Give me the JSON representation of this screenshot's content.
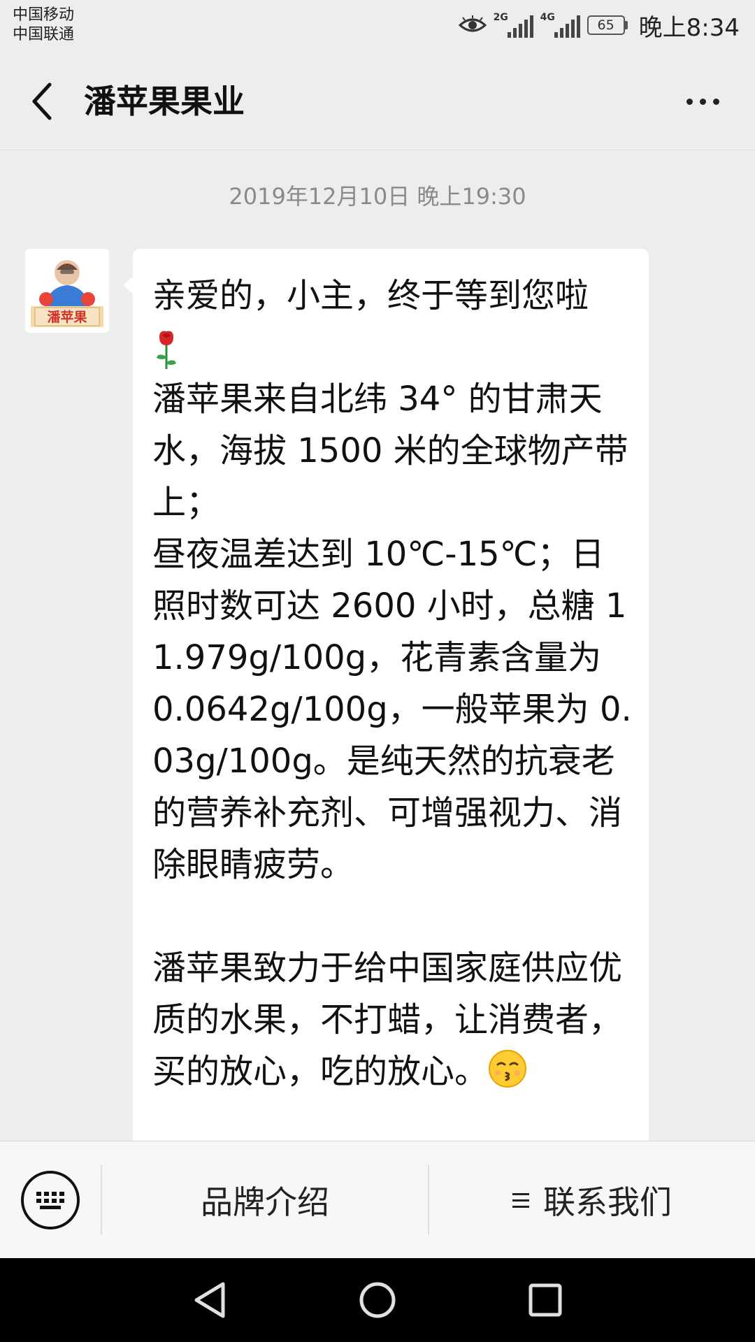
{
  "status_bar": {
    "carrier_1": "中国移动",
    "carrier_2": "中国联通",
    "signal_1_label": "2G",
    "signal_2_label": "4G",
    "battery": "65",
    "time": "晚上8:34"
  },
  "header": {
    "title": "潘苹果果业",
    "back_icon": "chevron-left-icon",
    "more_icon": "more-icon"
  },
  "chat": {
    "timestamp": "2019年12月10日 晚上19:30",
    "avatar_text": "潘苹果",
    "message": {
      "line1": "亲爱的，小主，终于等到您啦",
      "para1": "潘苹果来自北纬 34° 的甘肃天水，海拔 1500 米的全球物产带上；",
      "para2": "昼夜温差达到 10℃-15℃；日照时数可达 2600 小时，总糖 11.979g/100g，花青素含量为 0.0642g/100g，一般苹果为 0.03g/100g。是纯天然的抗衰老的营养补充剂、可增强视力、消除眼睛疲劳。",
      "para3": "潘苹果致力于给中国家庭供应优质的水果，不打蜡，让消费者，买的放心，吃的放心。",
      "emoji_1": "rose-icon",
      "emoji_2": "kissing-face-icon"
    }
  },
  "menu": {
    "keyboard_icon": "keyboard-icon",
    "item_1": "品牌介绍",
    "item_2": "联系我们",
    "item_2_icon": "menu-icon"
  },
  "nav": {
    "back": "nav-back-icon",
    "home": "nav-home-icon",
    "recents": "nav-recents-icon"
  },
  "colors": {
    "background": "#ededed",
    "bubble": "#ffffff",
    "navbar": "#000000"
  }
}
